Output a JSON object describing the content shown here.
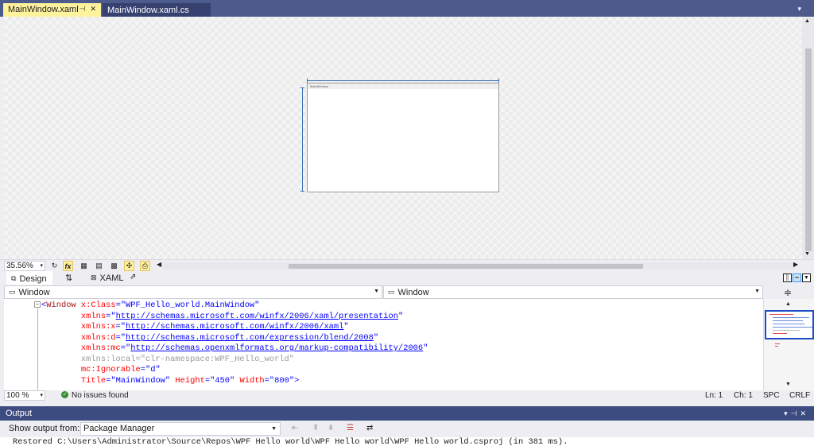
{
  "tabs": {
    "active": {
      "label": "MainWindow.xaml",
      "pin": "⊣",
      "close": "✕"
    },
    "inactive": {
      "label": "MainWindow.xaml.cs"
    },
    "menu_glyph": "▾"
  },
  "designer": {
    "window_title": "MainWindow",
    "zoom": "35.56%",
    "fx_label": "fx"
  },
  "view_tabs": {
    "design": "Design",
    "swap": "⇅",
    "xaml": "XAML"
  },
  "nav": {
    "left": "Window",
    "right": "Window"
  },
  "code": {
    "line1": {
      "open": "<",
      "tag": "Window",
      "attr": " x:Class",
      "eq": "=",
      "val": "\"WPF_Hello_world.MainWindow\""
    },
    "line2": {
      "attr": "xmlns",
      "eq": "=\"",
      "link": "http://schemas.microsoft.com/winfx/2006/xaml/presentation",
      "close": "\""
    },
    "line3": {
      "attr": "xmlns:x",
      "eq": "=\"",
      "link": "http://schemas.microsoft.com/winfx/2006/xaml",
      "close": "\""
    },
    "line4": {
      "attr": "xmlns:d",
      "eq": "=\"",
      "link": "http://schemas.microsoft.com/expression/blend/2008",
      "close": "\""
    },
    "line5": {
      "attr": "xmlns:mc",
      "eq": "=\"",
      "link": "http://schemas.openxmlformats.org/markup-compatibility/2006",
      "close": "\""
    },
    "line6": {
      "text": "xmlns:local=\"clr-namespace:WPF_Hello_world\""
    },
    "line7": {
      "attr": "mc:Ignorable",
      "eq": "=",
      "val": "\"d\""
    },
    "line8": {
      "a1": "Title",
      "v1": "\"MainWindow\"",
      "a2": " Height",
      "v2": "\"450\"",
      "a3": " Width",
      "v3": "\"800\"",
      "end": ">"
    }
  },
  "status": {
    "zoom": "100 %",
    "issues": "No issues found",
    "line": "Ln: 1",
    "col": "Ch: 1",
    "spc": "SPC",
    "eol": "CRLF"
  },
  "output": {
    "title": "Output",
    "show_from_label": "Show output from:",
    "source": "Package Manager",
    "text": "Restored C:\\Users\\Administrator\\Source\\Repos\\WPF Hello world\\WPF Hello world\\WPF Hello world.csproj (in 381 ms)."
  }
}
